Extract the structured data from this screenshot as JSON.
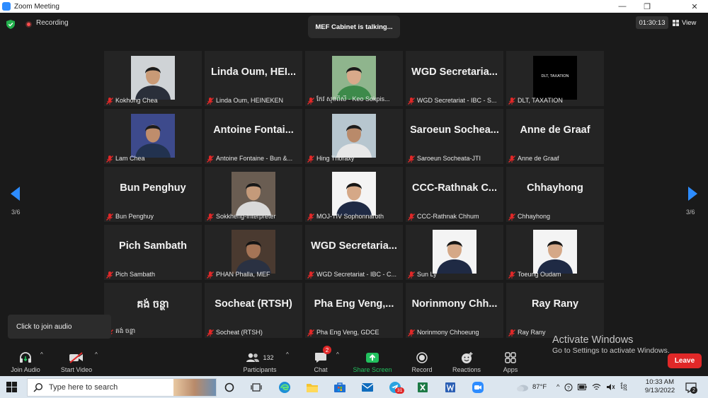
{
  "window": {
    "title": "Zoom Meeting"
  },
  "top": {
    "recording_label": "Recording",
    "talking": "MEF Cabinet is talking...",
    "timer": "01:30:13",
    "view_label": "View"
  },
  "pager": {
    "left": "3/6",
    "right": "3/6"
  },
  "tiles": [
    {
      "big": "",
      "photo": "man-suit",
      "caption": "Kokhong Chea"
    },
    {
      "big": "Linda Oum, HEI...",
      "photo": "",
      "caption": "Linda Oum, HEINEKEN"
    },
    {
      "big": "",
      "photo": "woman-speaker",
      "caption": "កែវ សុខពិសី - Keo Sokpis..."
    },
    {
      "big": "WGD Secretaria...",
      "photo": "",
      "caption": "WGD Secretariat - IBC - S..."
    },
    {
      "big": "",
      "photo": "dlt-logo",
      "caption": "DLT, TAXATION"
    },
    {
      "big": "",
      "photo": "man-flags",
      "caption": "Lam Chea"
    },
    {
      "big": "Antoine Fontai...",
      "photo": "",
      "caption": "Antoine Fontaine - Bun &..."
    },
    {
      "big": "",
      "photo": "man-map",
      "caption": "Hing Thoraxy"
    },
    {
      "big": "Saroeun Sochea...",
      "photo": "",
      "caption": "Saroeun Socheata-JTI"
    },
    {
      "big": "Anne de Graaf",
      "photo": "",
      "caption": "Anne de Graaf"
    },
    {
      "big": "Bun Penghuy",
      "photo": "",
      "caption": "Bun Penghuy"
    },
    {
      "big": "",
      "photo": "man-room",
      "caption": "Sokkheng-Interpreter"
    },
    {
      "big": "",
      "photo": "man-white",
      "caption": "MOJ-TIV Sophonnaroth"
    },
    {
      "big": "CCC-Rathnak C...",
      "photo": "",
      "caption": "CCC-Rathnak Chhum"
    },
    {
      "big": "Chhayhong",
      "photo": "",
      "caption": "Chhayhong"
    },
    {
      "big": "Pich Sambath",
      "photo": "",
      "caption": "Pich Sambath"
    },
    {
      "big": "",
      "photo": "man-office",
      "caption": "PHAN Phalla, MEF"
    },
    {
      "big": "WGD Secretaria...",
      "photo": "",
      "caption": "WGD Secretariat - IBC - C..."
    },
    {
      "big": "",
      "photo": "man-white",
      "caption": "Sun Ly"
    },
    {
      "big": "",
      "photo": "man-white",
      "caption": "Toeung Oudam"
    },
    {
      "big": "គង់ ចន្ថា",
      "photo": "",
      "caption": "គង់ ចន្ថា"
    },
    {
      "big": "Socheat (RTSH)",
      "photo": "",
      "caption": "Socheat (RTSH)"
    },
    {
      "big": "Pha Eng Veng,...",
      "photo": "",
      "caption": "Pha Eng Veng, GDCE"
    },
    {
      "big": "Norinmony Chh...",
      "photo": "",
      "caption": "Norinmony Chhoeung"
    },
    {
      "big": "Ray Rany",
      "photo": "",
      "caption": "Ray Rany"
    }
  ],
  "dlt_logo_text": "DLT, TAXATION",
  "tooltip": "Click to join audio",
  "toolbar": {
    "join_audio": "Join Audio",
    "start_video": "Start Video",
    "participants": "Participants",
    "participants_count": "132",
    "chat": "Chat",
    "chat_badge": "2",
    "share_screen": "Share Screen",
    "record": "Record",
    "reactions": "Reactions",
    "apps": "Apps",
    "leave": "Leave"
  },
  "activate": {
    "line1": "Activate Windows",
    "line2": "Go to Settings to activate Windows."
  },
  "taskbar": {
    "search_placeholder": "Type here to search",
    "weather": "87°F",
    "time": "10:33 AM",
    "date": "9/13/2022",
    "notif_count": "2",
    "telegram_badge": "31"
  },
  "colors": {
    "accent": "#2d8cff",
    "leave": "#e02828",
    "share": "#22c15e",
    "mic_muted": "#e02828"
  }
}
